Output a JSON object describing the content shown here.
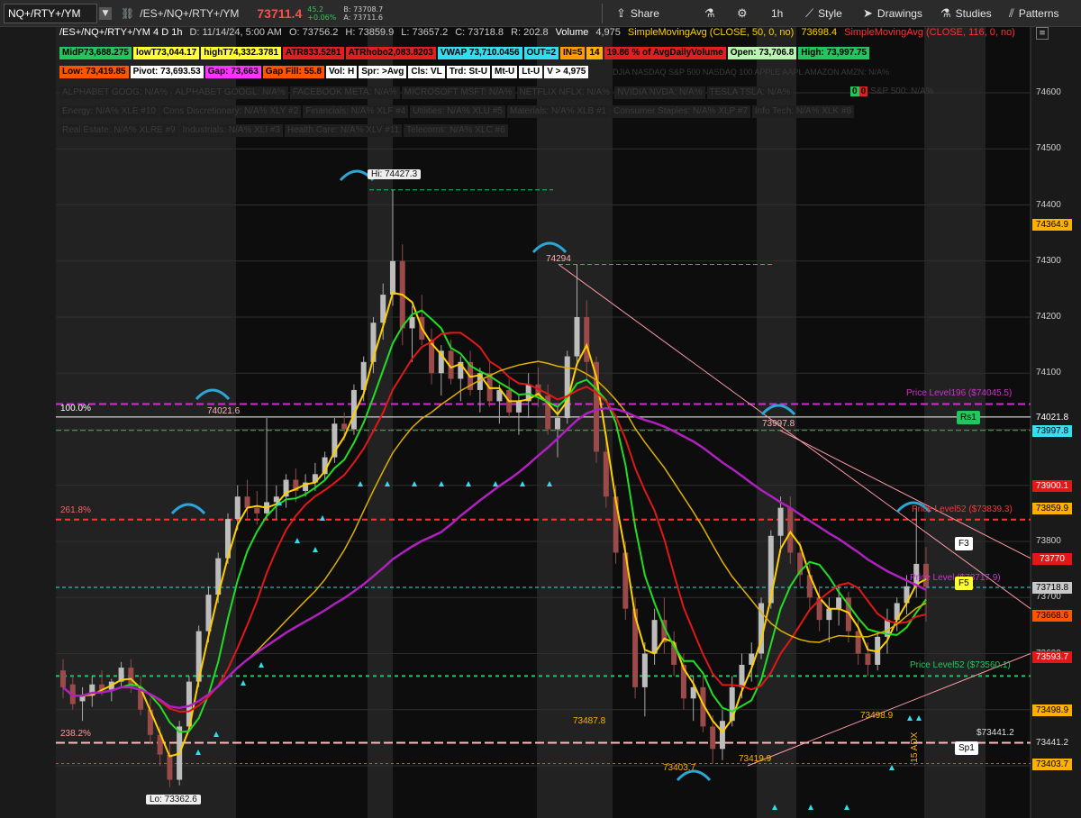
{
  "toolbar": {
    "symbol": "NQ+/RTY+/YM",
    "title": "/ES+/NQ+/RTY+/YM",
    "last_price": "73711.4",
    "change": "45.2",
    "change_pct": "+0.06%",
    "bid": "B: 73708.7",
    "ask": "A: 73711.6",
    "share": "Share",
    "timeframe": "1h",
    "style": "Style",
    "drawings": "Drawings",
    "studies": "Studies",
    "patterns": "Patterns"
  },
  "header": {
    "name": "/ES+/NQ+/RTY+/YM 4 D 1h",
    "date": "D: 11/14/24, 5:00 AM",
    "open": "O: 73756.2",
    "high": "H: 73859.9",
    "low": "L: 73657.2",
    "close": "C: 73718.8",
    "range": "R: 202.8",
    "volume_label": "Volume",
    "volume": "4,975",
    "sma1": "SimpleMovingAvg (CLOSE, 50, 0, no)",
    "sma1_val": "73698.4",
    "sma2": "SimpleMovingAvg (CLOSE, 116, 0, no)"
  },
  "badges_row1": [
    {
      "t": "MidP73,688.275",
      "bg": "#22c55e"
    },
    {
      "t": "lowT73,044.17",
      "bg": "#ffff33"
    },
    {
      "t": "highT74,332.3781",
      "bg": "#ffff33"
    },
    {
      "t": "ATR833.5281",
      "bg": "#e02020"
    },
    {
      "t": "ATRhobo2,083.8203",
      "bg": "#e02020"
    },
    {
      "t": "VWAP 73,710.0456",
      "bg": "#33ddee"
    },
    {
      "t": "OUT=2",
      "bg": "#33ddee"
    },
    {
      "t": "IN=5",
      "bg": "#ff9900"
    },
    {
      "t": "14",
      "bg": "#ffb000"
    },
    {
      "t": "19.86 % of AvgDailyVolume",
      "bg": "#e02020"
    },
    {
      "t": "Open: 73,706.8",
      "bg": "#b9f5b0"
    },
    {
      "t": "High: 73,997.75",
      "bg": "#22c55e"
    }
  ],
  "badges_row2": [
    {
      "t": "Low: 73,419.85",
      "bg": "#ff5500"
    },
    {
      "t": "Pivot: 73,693.53",
      "bg": "#ffffff"
    },
    {
      "t": "Gap: 73,663",
      "bg": "#ff33ff"
    },
    {
      "t": "Gap Fill: 55.8",
      "bg": "#ff5500"
    },
    {
      "t": "Vol: H",
      "bg": "#ffffff"
    },
    {
      "t": "Spr: >Avg",
      "bg": "#ffffff"
    },
    {
      "t": "Cls: VL",
      "bg": "#ffffff"
    },
    {
      "t": "Trd: St-U",
      "bg": "#ffffff"
    },
    {
      "t": "Mt-U",
      "bg": "#ffffff"
    },
    {
      "t": "Lt-U",
      "bg": "#ffffff"
    },
    {
      "t": "V > 4,975",
      "bg": "#ffffff"
    }
  ],
  "badges_row3": [
    "ALPHABET GOOG: N/A%",
    "ALPHABET GOOGL: N/A%",
    "FACEBOOK META: N/A%",
    "MICROSOFT MSFT: N/A%",
    "NETFLIX NFLX: N/A%",
    "NVIDIA NVDA: N/A%",
    "TESLA TSLA: N/A%"
  ],
  "badges_row4": [
    "Energy: N/A% XLE #10",
    "Cons Discretionary: N/A% XLY #2",
    "Financials: N/A% XLF #4",
    "Utilities: N/A% XLU #5",
    "Materials: N/A% XLB #1",
    "Consumer Staples: N/A% XLP #7",
    "Info Tech: N/A% XLK #8"
  ],
  "badges_row5": [
    "Real Estate: N/A% XLRE #9",
    "Industrials: N/A% XLI #3",
    "Health Care: N/A% XLV #11",
    "Telecoms: N/A% XLC #6"
  ],
  "ticker_strip": "DJIA  NASDAQ  S&P 500  NASDAQ 100  APPLE AAPL  AMAZON AMZN: N/A%",
  "sp500_badge": "S&P 500: N/A%",
  "right_tags": [
    {
      "v": "74364.9",
      "bg": "#ffb000",
      "fg": "#000"
    },
    {
      "v": "74021.8",
      "bg": "#1a1a1a",
      "fg": "#ffffff"
    },
    {
      "v": "73997.8",
      "bg": "#35e0ee",
      "fg": "#000"
    },
    {
      "v": "73900.1",
      "bg": "#e01818",
      "fg": "#fff"
    },
    {
      "v": "73859.9",
      "bg": "#ffb000",
      "fg": "#000"
    },
    {
      "v": "73770",
      "bg": "#e01818",
      "fg": "#fff"
    },
    {
      "v": "73718.8",
      "bg": "#c8c8c8",
      "fg": "#000"
    },
    {
      "v": "73668.6",
      "bg": "#ff5500",
      "fg": "#000"
    },
    {
      "v": "73593.7",
      "bg": "#e01818",
      "fg": "#fff"
    },
    {
      "v": "73498.9",
      "bg": "#ffb000",
      "fg": "#000"
    },
    {
      "v": "73441.2",
      "bg": "#1a1a1a",
      "fg": "#dddddd"
    },
    {
      "v": "73403.7",
      "bg": "#ffb000",
      "fg": "#000"
    }
  ],
  "chart_data": {
    "type": "candlestick",
    "ylim": [
      73290,
      74660
    ],
    "y_ticks": [
      73400,
      73500,
      73600,
      73700,
      73800,
      73900,
      74000,
      74100,
      74200,
      74300,
      74400,
      74500,
      74600
    ],
    "candles": [
      [
        73570,
        73590,
        73520,
        73540
      ],
      [
        73545,
        73560,
        73500,
        73510
      ],
      [
        73515,
        73540,
        73480,
        73525
      ],
      [
        73525,
        73560,
        73505,
        73545
      ],
      [
        73545,
        73570,
        73525,
        73535
      ],
      [
        73535,
        73555,
        73515,
        73550
      ],
      [
        73550,
        73585,
        73540,
        73575
      ],
      [
        73575,
        73590,
        73530,
        73540
      ],
      [
        73540,
        73560,
        73490,
        73500
      ],
      [
        73500,
        73520,
        73440,
        73455
      ],
      [
        73455,
        73470,
        73400,
        73420
      ],
      [
        73420,
        73440,
        73362,
        73375
      ],
      [
        73375,
        73480,
        73365,
        73470
      ],
      [
        73470,
        73560,
        73460,
        73550
      ],
      [
        73550,
        73650,
        73540,
        73640
      ],
      [
        73640,
        73720,
        73620,
        73705
      ],
      [
        73705,
        73780,
        73690,
        73770
      ],
      [
        73770,
        73850,
        73760,
        73840
      ],
      [
        73840,
        73900,
        73820,
        73880
      ],
      [
        73880,
        73910,
        73840,
        73860
      ],
      [
        73860,
        73890,
        73830,
        73850
      ],
      [
        73850,
        74020,
        73840,
        73870
      ],
      [
        73870,
        73900,
        73840,
        73880
      ],
      [
        73880,
        73920,
        73860,
        73910
      ],
      [
        73910,
        73930,
        73870,
        73890
      ],
      [
        73890,
        73920,
        73880,
        73905
      ],
      [
        73905,
        73940,
        73890,
        73920
      ],
      [
        73920,
        73960,
        73910,
        73950
      ],
      [
        73950,
        74020,
        73940,
        74010
      ],
      [
        74010,
        74030,
        73980,
        74000
      ],
      [
        74000,
        74080,
        73990,
        74070
      ],
      [
        74070,
        74130,
        74050,
        74120
      ],
      [
        74120,
        74200,
        74100,
        74190
      ],
      [
        74190,
        74260,
        74160,
        74240
      ],
      [
        74240,
        74427,
        74220,
        74300
      ],
      [
        74300,
        74330,
        74150,
        74180
      ],
      [
        74180,
        74220,
        74120,
        74200
      ],
      [
        74200,
        74240,
        74150,
        74160
      ],
      [
        74160,
        74180,
        74080,
        74100
      ],
      [
        74100,
        74150,
        74060,
        74140
      ],
      [
        74140,
        74160,
        74080,
        74090
      ],
      [
        74090,
        74130,
        74050,
        74120
      ],
      [
        74120,
        74140,
        74060,
        74070
      ],
      [
        74070,
        74110,
        74030,
        74100
      ],
      [
        74100,
        74120,
        74040,
        74050
      ],
      [
        74050,
        74080,
        74010,
        74070
      ],
      [
        74070,
        74090,
        74020,
        74030
      ],
      [
        74030,
        74060,
        73990,
        74050
      ],
      [
        74050,
        74100,
        74020,
        74080
      ],
      [
        74080,
        74110,
        74040,
        74060
      ],
      [
        74060,
        74080,
        73990,
        74000
      ],
      [
        74000,
        74040,
        73950,
        74020
      ],
      [
        74020,
        74140,
        74010,
        74130
      ],
      [
        74130,
        74294,
        74120,
        74200
      ],
      [
        74200,
        74230,
        74090,
        74120
      ],
      [
        74120,
        74130,
        73940,
        73960
      ],
      [
        73960,
        73990,
        73860,
        73880
      ],
      [
        73880,
        73900,
        73760,
        73780
      ],
      [
        73780,
        73800,
        73660,
        73680
      ],
      [
        73680,
        73700,
        73520,
        73540
      ],
      [
        73540,
        73620,
        73488,
        73600
      ],
      [
        73600,
        73680,
        73580,
        73660
      ],
      [
        73660,
        73700,
        73600,
        73620
      ],
      [
        73620,
        73640,
        73560,
        73580
      ],
      [
        73580,
        73600,
        73500,
        73520
      ],
      [
        73520,
        73560,
        73480,
        73540
      ],
      [
        73540,
        73560,
        73460,
        73470
      ],
      [
        73470,
        73490,
        73404,
        73430
      ],
      [
        73430,
        73500,
        73410,
        73480
      ],
      [
        73480,
        73560,
        73470,
        73540
      ],
      [
        73540,
        73600,
        73520,
        73580
      ],
      [
        73580,
        73620,
        73550,
        73600
      ],
      [
        73600,
        73700,
        73590,
        73690
      ],
      [
        73690,
        73820,
        73680,
        73810
      ],
      [
        73810,
        73880,
        73780,
        73860
      ],
      [
        73860,
        73880,
        73760,
        73780
      ],
      [
        73780,
        73800,
        73720,
        73740
      ],
      [
        73740,
        73760,
        73680,
        73700
      ],
      [
        73700,
        73720,
        73640,
        73660
      ],
      [
        73660,
        73700,
        73620,
        73680
      ],
      [
        73680,
        73720,
        73650,
        73700
      ],
      [
        73700,
        73710,
        73620,
        73640
      ],
      [
        73640,
        73660,
        73580,
        73600
      ],
      [
        73600,
        73620,
        73560,
        73580
      ],
      [
        73580,
        73640,
        73570,
        73630
      ],
      [
        73630,
        73680,
        73600,
        73660
      ],
      [
        73660,
        73700,
        73640,
        73690
      ],
      [
        73690,
        73740,
        73670,
        73720
      ],
      [
        73720,
        73860,
        73700,
        73760
      ],
      [
        73760,
        73790,
        73657,
        73719
      ]
    ]
  },
  "annotations": {
    "hi": "Hi: 74427.3",
    "lo": "Lo: 73362.6",
    "pct100": "100.0%",
    "pct261": "261.8%",
    "pct238": "238.2%",
    "l74021": "74021.6",
    "l74294": "74294",
    "l73998": "73997.8",
    "l73488": "73487.8",
    "l73404": "73403.7",
    "l73420": "73419.9",
    "l73499": "73498.9",
    "pl196": "Price Level196 ($74045.5)",
    "pl52a": "Price Level52 ($73839.3)",
    "pl52b": "Price Level52 ($73560.1)",
    "pl_mid": "Price Level ($73717.9)",
    "r73441": "$73441.2",
    "adx": "-15 ADX",
    "rs1": "Rs1",
    "f3": "F3",
    "f5": "F5",
    "sp1": "Sp1"
  }
}
